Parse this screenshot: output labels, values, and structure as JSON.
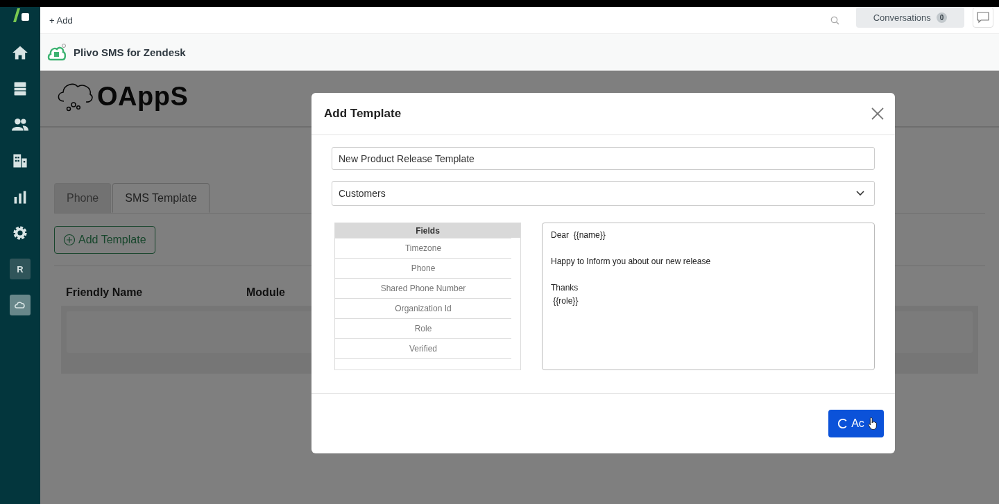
{
  "top_bar": {
    "add_label": "+ Add",
    "conversations": {
      "label": "Conversations",
      "count": "0"
    }
  },
  "sidebar": {
    "items": [
      {
        "kind": "home",
        "selected": false
      },
      {
        "kind": "views",
        "selected": false
      },
      {
        "kind": "customers",
        "selected": false
      },
      {
        "kind": "organizations",
        "selected": false
      },
      {
        "kind": "reports",
        "selected": false
      },
      {
        "kind": "settings",
        "selected": false
      },
      {
        "kind": "letter-app",
        "letter": "R",
        "selected": false
      },
      {
        "kind": "cloud-app",
        "selected": true
      }
    ]
  },
  "app_bar": {
    "title": "Plivo SMS for Zendesk"
  },
  "page": {
    "brand": "OAppS",
    "tabs": [
      {
        "label": "Phone",
        "selected": false
      },
      {
        "label": "SMS Template",
        "selected": true
      }
    ],
    "add_button": "Add Template",
    "table": {
      "columns": [
        "Friendly Name",
        "Module"
      ]
    }
  },
  "modal": {
    "title": "Add Template",
    "name_value": "New Product Release Template",
    "module_value": "Customers",
    "fields_heading": "Fields",
    "fields": [
      "Timezone",
      "Phone",
      "Shared Phone Number",
      "Organization Id",
      "Role",
      "Verified"
    ],
    "message": "Dear  {{name}}\n\nHappy to Inform you about our new release\n\nThanks\n {{role}}",
    "submit": {
      "label": "Ac",
      "loading": true
    }
  }
}
